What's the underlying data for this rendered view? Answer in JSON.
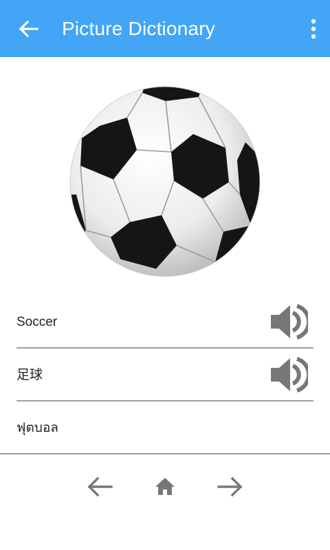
{
  "app_bar": {
    "title": "Picture Dictionary",
    "back_icon": "arrow-left-icon",
    "menu_icon": "more-vertical-icon",
    "color": "#42a5f5"
  },
  "picture": {
    "subject": "soccer-ball-image"
  },
  "words": [
    {
      "text": "Soccer",
      "has_audio": true,
      "audio_icon": "speaker-icon"
    },
    {
      "text": "足球",
      "has_audio": true,
      "audio_icon": "speaker-icon"
    },
    {
      "text": "ฟุตบอล",
      "has_audio": false
    }
  ],
  "bottom_nav": {
    "prev_icon": "arrow-left-icon",
    "home_icon": "home-icon",
    "next_icon": "arrow-right-icon"
  },
  "colors": {
    "icon_gray": "#777777",
    "divider": "#9e9e9e"
  }
}
